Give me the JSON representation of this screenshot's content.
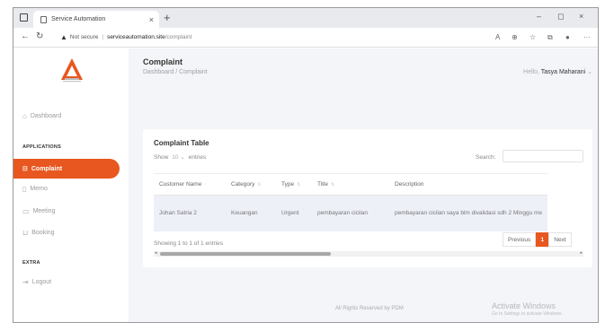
{
  "browser": {
    "tab_title": "Service Automation",
    "tab_close": "×",
    "new_tab": "+",
    "window_controls": {
      "minimize": "–",
      "maximize": "◻",
      "close": "×"
    },
    "address": {
      "security": "Not secure",
      "domain": "serviceautomation.site",
      "path": "/complaint"
    }
  },
  "sidebar": {
    "dashboard_label": "Dashboard",
    "applications_heading": "APPLICATIONS",
    "items": [
      {
        "label": "Complaint",
        "active": true
      },
      {
        "label": "Memo"
      },
      {
        "label": "Meeting"
      },
      {
        "label": "Booking"
      }
    ],
    "extra_heading": "EXTRA",
    "logout_label": "Logout"
  },
  "header": {
    "title": "Complaint",
    "breadcrumb": "Dashboard / Complaint",
    "greeting": "Hello,",
    "user_name": "Tasya Maharani",
    "user_caret": "⌄"
  },
  "table_card": {
    "title": "Complaint Table",
    "show_label": "Show",
    "show_value": "10",
    "entries_label": "entries",
    "search_label": "Search:",
    "search_value": "",
    "columns": [
      "Customer Name",
      "Category",
      "Type",
      "Title",
      "Description"
    ],
    "rows": [
      [
        "Johan Satria 2",
        "Keuangan",
        "Urgent",
        "pembayaran cicilan",
        "pembayaran cicilan saya blm divalidasi sdh 2 Minggu me"
      ]
    ],
    "info": "Showing 1 to 1 of 1 entries",
    "pagination": {
      "previous": "Previous",
      "page": "1",
      "next": "Next"
    }
  },
  "footer": "All Rights Reserved by PDM",
  "windows_notice": {
    "line1": "Activate Windows",
    "line2": "Go to Settings to activate Windows."
  },
  "colors": {
    "accent": "#e8571f",
    "main_bg": "#f4f5f9"
  }
}
